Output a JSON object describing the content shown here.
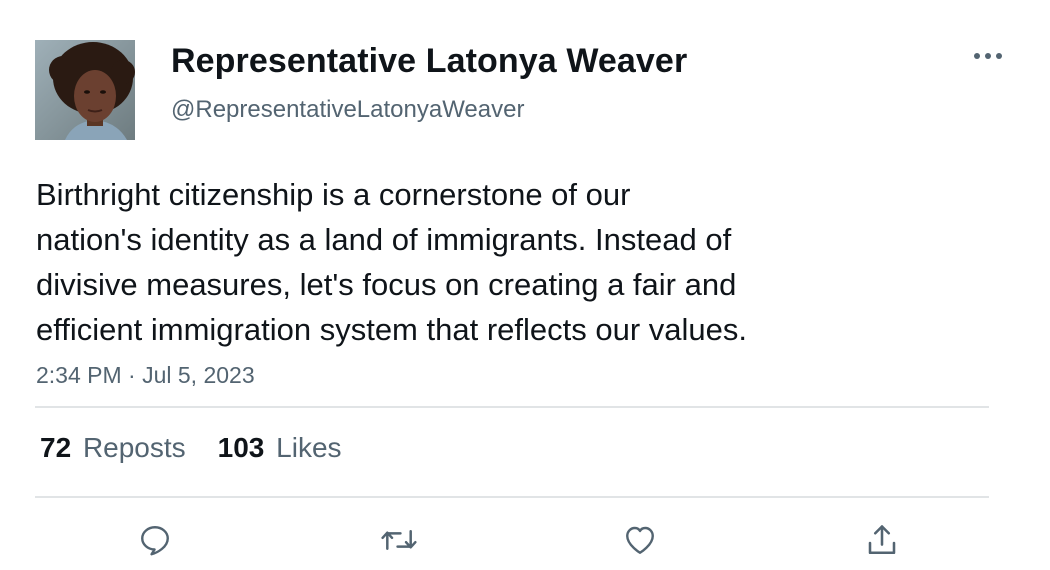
{
  "author": {
    "display_name": "Representative Latonya Weaver",
    "handle": "@RepresentativeLatonyaWeaver"
  },
  "tweet": {
    "text_lines": [
      "Birthright citizenship is a cornerstone of our",
      "nation's identity as a land of immigrants. Instead of",
      "divisive measures, let's focus on creating a fair and",
      "efficient immigration system that reflects our values."
    ],
    "timestamp": "2:34 PM · Jul 5, 2023"
  },
  "stats": {
    "reposts_count": "72",
    "reposts_label": "Reposts",
    "likes_count": "103",
    "likes_label": "Likes"
  },
  "icons": {
    "more": "more-options-icon",
    "reply": "reply-icon",
    "repost": "repost-icon",
    "like": "like-icon",
    "share": "share-icon"
  },
  "colors": {
    "text_primary": "#0f1419",
    "text_secondary": "#536471",
    "divider": "#e1e4e6"
  }
}
